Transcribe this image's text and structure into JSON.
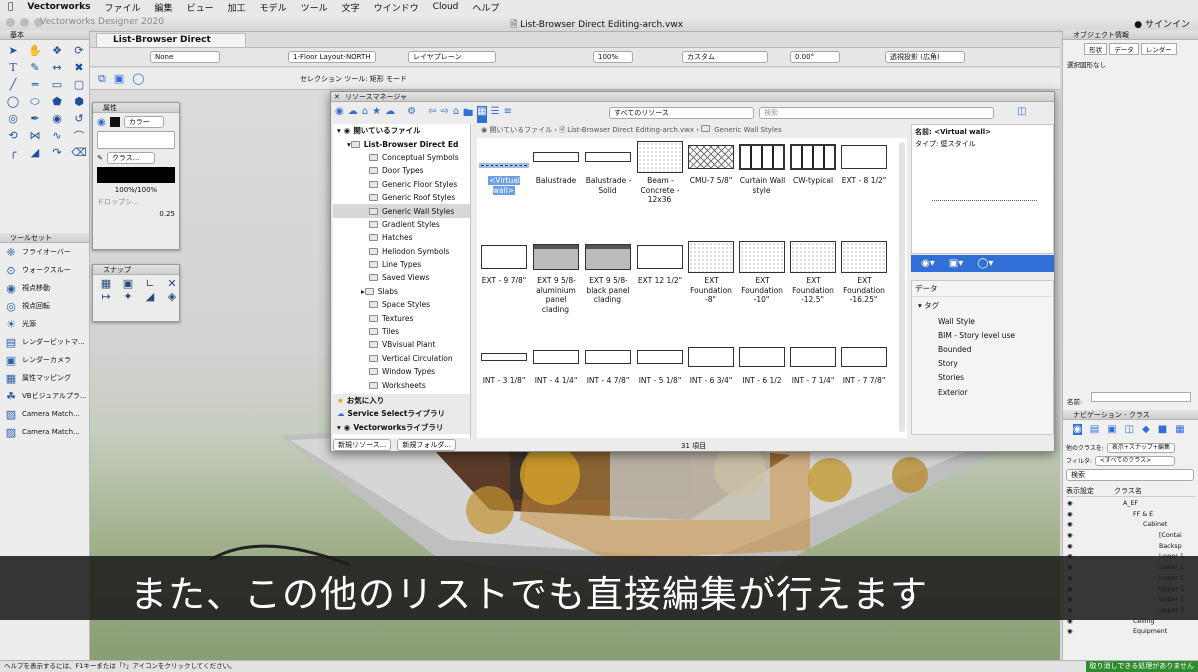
{
  "menubar": {
    "app": "Vectorworks",
    "items": [
      "ファイル",
      "編集",
      "ビュー",
      "加工",
      "モデル",
      "ツール",
      "文字",
      "ウインドウ",
      "Cloud",
      "ヘルプ"
    ]
  },
  "window": {
    "app_version": "Vectorworks Designer 2020",
    "title": "List-Browser Direct Editing-arch.vwx",
    "sign_in": "サインイン",
    "doc_tab": "List-Browser Direct Editing-..."
  },
  "toolbar": {
    "class_dropdown": "None",
    "layer_dropdown": "1-Floor Layout-NORTH",
    "plane_dropdown": "レイヤプレーン",
    "zoom": "100%",
    "view_dropdown": "カスタム",
    "angle": "0.00°",
    "projection": "透視投影 (広角)",
    "mode_label": "セレクション ツール: 矩形 モード"
  },
  "left_panel": {
    "basic_title": "基本",
    "toolsets_title": "ツールセット",
    "toolset_items": [
      {
        "icon": "flyover-icon",
        "label": "フライオーバー"
      },
      {
        "icon": "walkthrough-icon",
        "label": "ウォークスルー"
      },
      {
        "icon": "view-move-icon",
        "label": "視点移動"
      },
      {
        "icon": "view-rotate-icon",
        "label": "視点回転"
      },
      {
        "icon": "light-icon",
        "label": "光源"
      },
      {
        "icon": "render-bitmap-icon",
        "label": "レンダービットマ..."
      },
      {
        "icon": "render-camera-icon",
        "label": "レンダーカメラ"
      },
      {
        "icon": "attribute-mapping-icon",
        "label": "属性マッピング"
      },
      {
        "icon": "vb-visual-icon",
        "label": "VBビジュアルプラ..."
      },
      {
        "icon": "camera-match-icon",
        "label": "Camera Match..."
      },
      {
        "icon": "camera-match-icon",
        "label": "Camera Match..."
      }
    ]
  },
  "attributes": {
    "title": "属性",
    "fill_label": "カラー",
    "pen_label": "クラス...",
    "opacity": "100%/100%",
    "shadow_label": "ドロップシ...",
    "line_weight": "0.25"
  },
  "snap": {
    "title": "スナップ"
  },
  "resource_manager": {
    "title": "リソースマネージャ",
    "filter": "すべてのリソース",
    "search_placeholder": "検索",
    "breadcrumb": [
      "開いているファイル",
      "List-Browser Direct Editing-arch.vwx",
      "Generic Wall Styles"
    ],
    "tree": {
      "open_files": "開いているファイル",
      "file": "List-Browser Direct Ed",
      "folders": [
        "Conceptual Symbols",
        "Door Types",
        "Generic Floor Styles",
        "Generic Roof Styles",
        "Generic Wall Styles",
        "Gradient Styles",
        "Hatches",
        "Heliodon Symbols",
        "Line Types",
        "Saved Views",
        "Slabs",
        "Space Styles",
        "Textures",
        "Tiles",
        "VBvisual Plant",
        "Vertical Circulation",
        "Window Types",
        "Worksheets"
      ],
      "selected_folder": "Generic Wall Styles",
      "favorites": "お気に入り",
      "service_select": "Service Selectライブラリ",
      "vw_library": "Vectorworksライブラリ"
    },
    "new_resource": "新規リソース...",
    "new_folder": "新規フォルダ...",
    "item_count": "31 項目",
    "resources": [
      {
        "label": "<Virtual wall>",
        "style": "virtual",
        "selected": true
      },
      {
        "label": "Balustrade",
        "style": "thin"
      },
      {
        "label": "Balustrade -Solid",
        "style": "thin"
      },
      {
        "label": "Beam - Concrete - 12x36",
        "style": "concrete"
      },
      {
        "label": "CMU-7 5/8\"",
        "style": "cmu"
      },
      {
        "label": "Curtain Wall style",
        "style": "curtain"
      },
      {
        "label": "CW-typical",
        "style": "curtain"
      },
      {
        "label": "EXT - 8 1/2\"",
        "style": "plain"
      },
      {
        "label": "EXT - 9 7/8\"",
        "style": "plain"
      },
      {
        "label": "EXT 9 5/8-aluminium panel clading",
        "style": "panel"
      },
      {
        "label": "EXT 9 5/8-black panel clading",
        "style": "panel"
      },
      {
        "label": "EXT 12 1/2\"",
        "style": "plain"
      },
      {
        "label": "EXT Foundation -8\"",
        "style": "concrete"
      },
      {
        "label": "EXT Foundation -10\"",
        "style": "concrete"
      },
      {
        "label": "EXT Foundation -12.5\"",
        "style": "concrete"
      },
      {
        "label": "EXT Foundation -16.25\"",
        "style": "concrete"
      },
      {
        "label": "INT - 3 1/8\"",
        "style": "thinline"
      },
      {
        "label": "INT - 4 1/4\"",
        "style": "mid"
      },
      {
        "label": "INT - 4 7/8\"",
        "style": "mid"
      },
      {
        "label": "INT - 5 1/8\"",
        "style": "mid"
      },
      {
        "label": "INT - 6 3/4\"",
        "style": "tall"
      },
      {
        "label": "INT - 6 1/2",
        "style": "tall"
      },
      {
        "label": "INT - 7 1/4\"",
        "style": "tall"
      },
      {
        "label": "INT - 7 7/8\"",
        "style": "tall"
      }
    ],
    "preview": {
      "name_label": "名前:",
      "name_value": "<Virtual wall>",
      "type_label": "タイプ:",
      "type_value": "壁スタイル"
    },
    "data_section": {
      "title": "データ",
      "tag_label": "タグ",
      "tags": [
        "Wall Style",
        "BIM - Story level use",
        "Bounded",
        "Story",
        "Stories",
        "Exterior"
      ]
    }
  },
  "object_info": {
    "title": "オブジェクト情報",
    "tabs": [
      "形状",
      "データ",
      "レンダー"
    ],
    "no_selection": "選択図形なし",
    "name_label": "名前:"
  },
  "navigation": {
    "title": "ナビゲーション - クラス",
    "class_label": "他のクラスを:",
    "class_value": "表示+スナップ+編集",
    "filter_label": "フィルタ:",
    "filter_value": "<すべてのクラス>",
    "search_placeholder": "検索",
    "col_visibility": "表示設定",
    "col_class": "クラス名",
    "classes": [
      "A_EF",
      "FF & E",
      "Cabinet",
      "[Contai",
      "Backsp",
      "Lower 1",
      "Lower 1",
      "Lower 1",
      "Upper 1",
      "Upper 1",
      "Upper 1",
      "Ceiling",
      "Equipment"
    ]
  },
  "subtitle": "また、この他のリストでも直接編集が行えます",
  "status": {
    "help": "ヘルプを表示するには、F1キーまたは「?」アイコンをクリックしてください。",
    "undo": "取り消しできる処理がありません"
  },
  "colors": {
    "accent": "#2f6fd6",
    "selection": "#6a9fe6",
    "subtitle_bg": "#1c1c1c"
  }
}
